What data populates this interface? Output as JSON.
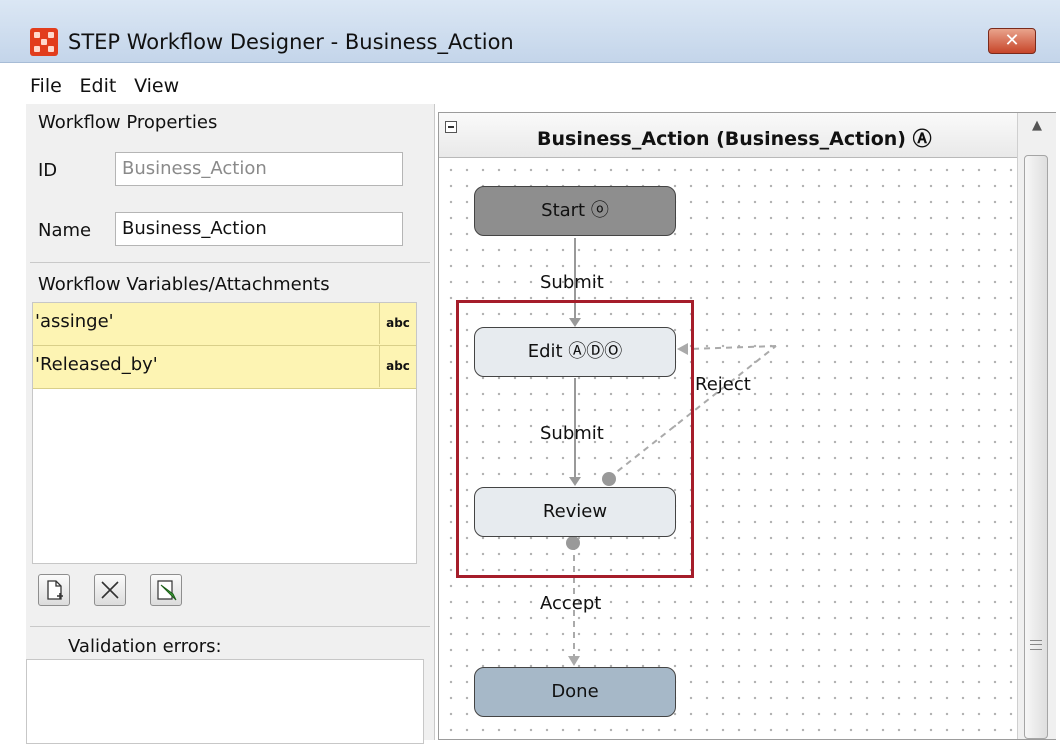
{
  "window": {
    "title": "STEP Workflow Designer - Business_Action",
    "close_label": "✕"
  },
  "menu": {
    "items": [
      "File",
      "Edit",
      "View"
    ]
  },
  "properties": {
    "section_title": "Workflow Properties",
    "id_label": "ID",
    "id_value": "Business_Action",
    "name_label": "Name",
    "name_value": "Business_Action"
  },
  "variables": {
    "section_title": "Workflow Variables/Attachments",
    "rows": [
      {
        "name": "'assinge'",
        "type": "abc"
      },
      {
        "name": "'Released_by'",
        "type": "abc"
      }
    ]
  },
  "validation": {
    "title": "Validation errors:"
  },
  "canvas": {
    "title": "Business_Action (Business_Action) Ⓐ",
    "nodes": {
      "start": "Start ⓞ",
      "edit": "Edit ⒶⒹⓄ",
      "review": "Review",
      "done": "Done"
    },
    "edges": {
      "submit1": "Submit",
      "submit2": "Submit",
      "reject": "Reject",
      "accept": "Accept"
    }
  },
  "colors": {
    "start_fill": "#8e8e8e",
    "edit_fill": "#e7ebef",
    "review_fill": "#e7ebef",
    "done_fill": "#a6b8c8",
    "highlight": "#a51d2a",
    "variable_row": "#fdf4b3"
  }
}
